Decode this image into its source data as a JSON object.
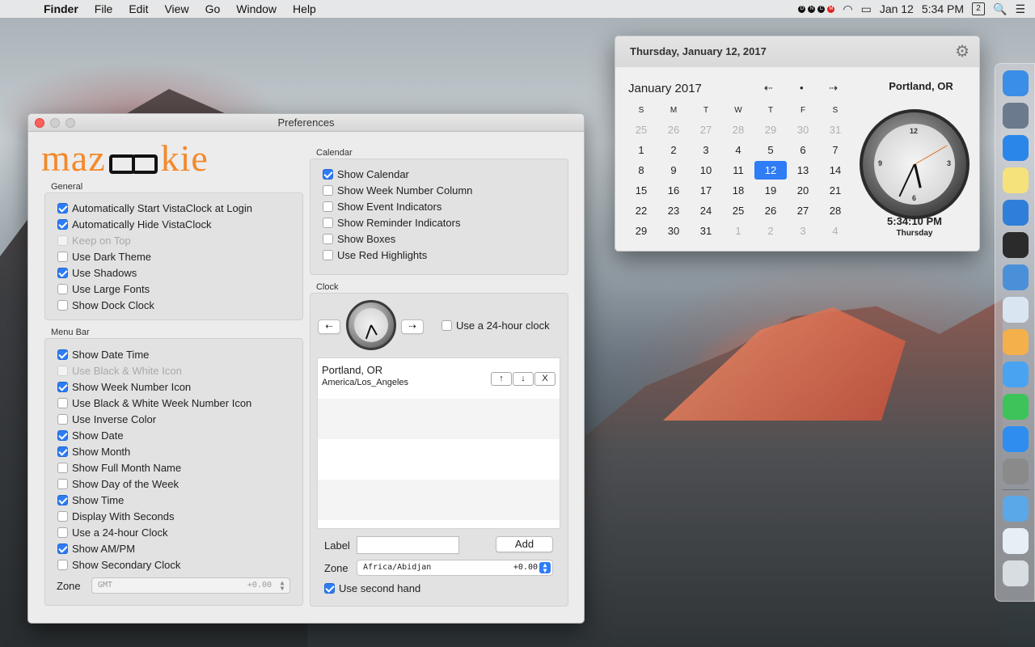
{
  "menubar": {
    "apple": "",
    "app": "Finder",
    "items": [
      "File",
      "Edit",
      "View",
      "Go",
      "Window",
      "Help"
    ],
    "status_letters": [
      "D",
      "N",
      "C",
      "M"
    ],
    "date": "Jan 12",
    "time": "5:34 PM",
    "week_badge": "2",
    "search_icon": "🔍",
    "list_icon": "☰",
    "wifi": "◠",
    "battery": "▭"
  },
  "prefs": {
    "title": "Preferences",
    "logo_left": "maz",
    "logo_right": "kie",
    "general": {
      "label": "General",
      "items": [
        {
          "label": "Automatically Start VistaClock at Login",
          "checked": true,
          "disabled": false
        },
        {
          "label": "Automatically Hide VistaClock",
          "checked": true,
          "disabled": false
        },
        {
          "label": "Keep on Top",
          "checked": false,
          "disabled": true
        },
        {
          "label": "Use Dark Theme",
          "checked": false,
          "disabled": false
        },
        {
          "label": "Use Shadows",
          "checked": true,
          "disabled": false
        },
        {
          "label": "Use Large Fonts",
          "checked": false,
          "disabled": false
        },
        {
          "label": "Show Dock Clock",
          "checked": false,
          "disabled": false
        }
      ]
    },
    "menubar_group": {
      "label": "Menu Bar",
      "items": [
        {
          "label": "Show Date Time",
          "checked": true,
          "disabled": false
        },
        {
          "label": "Use Black & White Icon",
          "checked": false,
          "disabled": true
        },
        {
          "label": "Show Week Number Icon",
          "checked": true,
          "disabled": false
        },
        {
          "label": "Use Black & White Week Number Icon",
          "checked": false,
          "disabled": false
        },
        {
          "label": "Use Inverse Color",
          "checked": false,
          "disabled": false
        },
        {
          "label": "Show Date",
          "checked": true,
          "disabled": false
        },
        {
          "label": "Show Month",
          "checked": true,
          "disabled": false
        },
        {
          "label": "Show Full Month Name",
          "checked": false,
          "disabled": false
        },
        {
          "label": "Show Day of the Week",
          "checked": false,
          "disabled": false
        },
        {
          "label": "Show Time",
          "checked": true,
          "disabled": false
        },
        {
          "label": "Display With Seconds",
          "checked": false,
          "disabled": false
        },
        {
          "label": "Use a 24-hour Clock",
          "checked": false,
          "disabled": false
        },
        {
          "label": "Show AM/PM",
          "checked": true,
          "disabled": false
        },
        {
          "label": "Show Secondary Clock",
          "checked": false,
          "disabled": false
        }
      ],
      "zone_label": "Zone",
      "zone_value": "GMT",
      "zone_offset": "+0.00"
    },
    "calendar": {
      "label": "Calendar",
      "items": [
        {
          "label": "Show Calendar",
          "checked": true
        },
        {
          "label": "Show Week Number Column",
          "checked": false
        },
        {
          "label": "Show Event Indicators",
          "checked": false
        },
        {
          "label": "Show Reminder Indicators",
          "checked": false
        },
        {
          "label": "Show Boxes",
          "checked": false
        },
        {
          "label": "Use Red Highlights",
          "checked": false
        }
      ]
    },
    "clock": {
      "label": "Clock",
      "prev": "⇠",
      "next": "⇢",
      "use24": "Use a 24-hour clock",
      "tz_city": "Portland, OR",
      "tz_id": "America/Los_Angeles",
      "up": "↑",
      "down": "↓",
      "remove": "X",
      "label_field_label": "Label",
      "label_field_value": "",
      "add_button": "Add",
      "zone_label": "Zone",
      "zone_value": "Africa/Abidjan",
      "zone_offset": "+0.00",
      "second_hand": "Use second hand",
      "second_hand_checked": true
    }
  },
  "popover": {
    "header": "Thursday, January 12, 2017",
    "gear": "⚙",
    "month": "January 2017",
    "prev": "⇠",
    "dot": "•",
    "next": "⇢",
    "weekdays": [
      "S",
      "M",
      "T",
      "W",
      "T",
      "F",
      "S"
    ],
    "days": [
      {
        "d": "25",
        "muted": true
      },
      {
        "d": "26",
        "muted": true
      },
      {
        "d": "27",
        "muted": true
      },
      {
        "d": "28",
        "muted": true
      },
      {
        "d": "29",
        "muted": true
      },
      {
        "d": "30",
        "muted": true
      },
      {
        "d": "31",
        "muted": true
      },
      {
        "d": "1"
      },
      {
        "d": "2"
      },
      {
        "d": "3"
      },
      {
        "d": "4"
      },
      {
        "d": "5"
      },
      {
        "d": "6"
      },
      {
        "d": "7"
      },
      {
        "d": "8"
      },
      {
        "d": "9"
      },
      {
        "d": "10"
      },
      {
        "d": "11"
      },
      {
        "d": "12",
        "today": true
      },
      {
        "d": "13"
      },
      {
        "d": "14"
      },
      {
        "d": "15"
      },
      {
        "d": "16"
      },
      {
        "d": "17"
      },
      {
        "d": "18"
      },
      {
        "d": "19"
      },
      {
        "d": "20"
      },
      {
        "d": "21"
      },
      {
        "d": "22"
      },
      {
        "d": "23"
      },
      {
        "d": "24"
      },
      {
        "d": "25"
      },
      {
        "d": "26"
      },
      {
        "d": "27"
      },
      {
        "d": "28"
      },
      {
        "d": "29"
      },
      {
        "d": "30"
      },
      {
        "d": "31"
      },
      {
        "d": "1",
        "muted": true
      },
      {
        "d": "2",
        "muted": true
      },
      {
        "d": "3",
        "muted": true
      },
      {
        "d": "4",
        "muted": true
      }
    ],
    "city": "Portland, OR",
    "clock_numerals": [
      "12",
      "3",
      "6",
      "9"
    ],
    "time": "5:34:10 PM",
    "day": "Thursday"
  },
  "dock": {
    "icons": [
      {
        "name": "finder-icon",
        "color": "#3a8ee6"
      },
      {
        "name": "launchpad-icon",
        "color": "#6b7a8c"
      },
      {
        "name": "safari-icon",
        "color": "#2a86e8"
      },
      {
        "name": "notes-icon",
        "color": "#f6e27a"
      },
      {
        "name": "xcode-icon",
        "color": "#2f7fd8"
      },
      {
        "name": "terminal-icon",
        "color": "#2b2b2b"
      },
      {
        "name": "quicktime-icon",
        "color": "#4a90d9"
      },
      {
        "name": "preview-icon",
        "color": "#d9e6f2"
      },
      {
        "name": "photos-icon",
        "color": "#f4b04a"
      },
      {
        "name": "messages-icon",
        "color": "#4aa3f0"
      },
      {
        "name": "facetime-icon",
        "color": "#3cc45a"
      },
      {
        "name": "app-store-icon",
        "color": "#2f8df0"
      },
      {
        "name": "system-preferences-icon",
        "color": "#8a8a8a"
      },
      {
        "name": "downloads-icon",
        "color": "#5aa8e8"
      },
      {
        "name": "screenshot-icon",
        "color": "#e6eef6"
      },
      {
        "name": "trash-icon",
        "color": "#d8dde2"
      }
    ]
  }
}
